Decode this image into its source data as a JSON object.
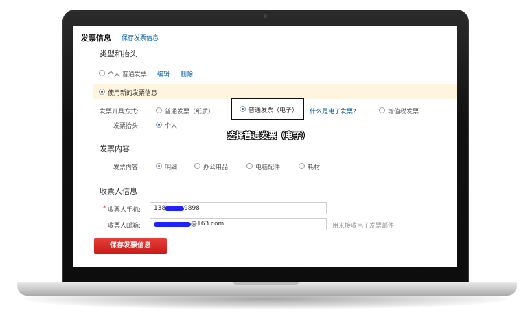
{
  "header": {
    "title": "发票信息",
    "save_link": "保存发票信息"
  },
  "type_section": {
    "title": "类型和抬头",
    "saved_option": {
      "label": "个人 普通发票",
      "edit": "编辑",
      "delete": "删除"
    },
    "new_option": {
      "label": "使用新的发票信息"
    },
    "method_label": "发票开具方式:",
    "methods": [
      {
        "label": "普通发票（纸质）",
        "selected": false
      },
      {
        "label": "普通发票（电子）",
        "selected": true
      },
      {
        "label": "增值税发票",
        "selected": false
      }
    ],
    "what_is_electronic": "什么是电子发票?",
    "title_label": "发票抬头:",
    "title_value": "个人"
  },
  "annotation": {
    "text": "选择普通发票（电子）",
    "highlight_color": "#111111"
  },
  "content_section": {
    "title": "发票内容",
    "label": "发票内容:",
    "options": [
      {
        "label": "明细",
        "selected": true
      },
      {
        "label": "办公用品",
        "selected": false
      },
      {
        "label": "电脑配件",
        "selected": false
      },
      {
        "label": "耗材",
        "selected": false
      }
    ]
  },
  "receiver_section": {
    "title": "收票人信息",
    "required_mark": "*",
    "phone_label": "收票人手机:",
    "phone_prefix": "138",
    "phone_suffix": "9898",
    "email_label": "收票人邮箱:",
    "email_suffix": "@163.com",
    "email_hint": "用来接收电子发票邮件",
    "redaction_color": "#1e22ff"
  },
  "actions": {
    "save_button": "保存发票信息",
    "button_color": "#d9302b"
  },
  "colors": {
    "link": "#005ea7",
    "info_bar": "#fff4dd"
  }
}
